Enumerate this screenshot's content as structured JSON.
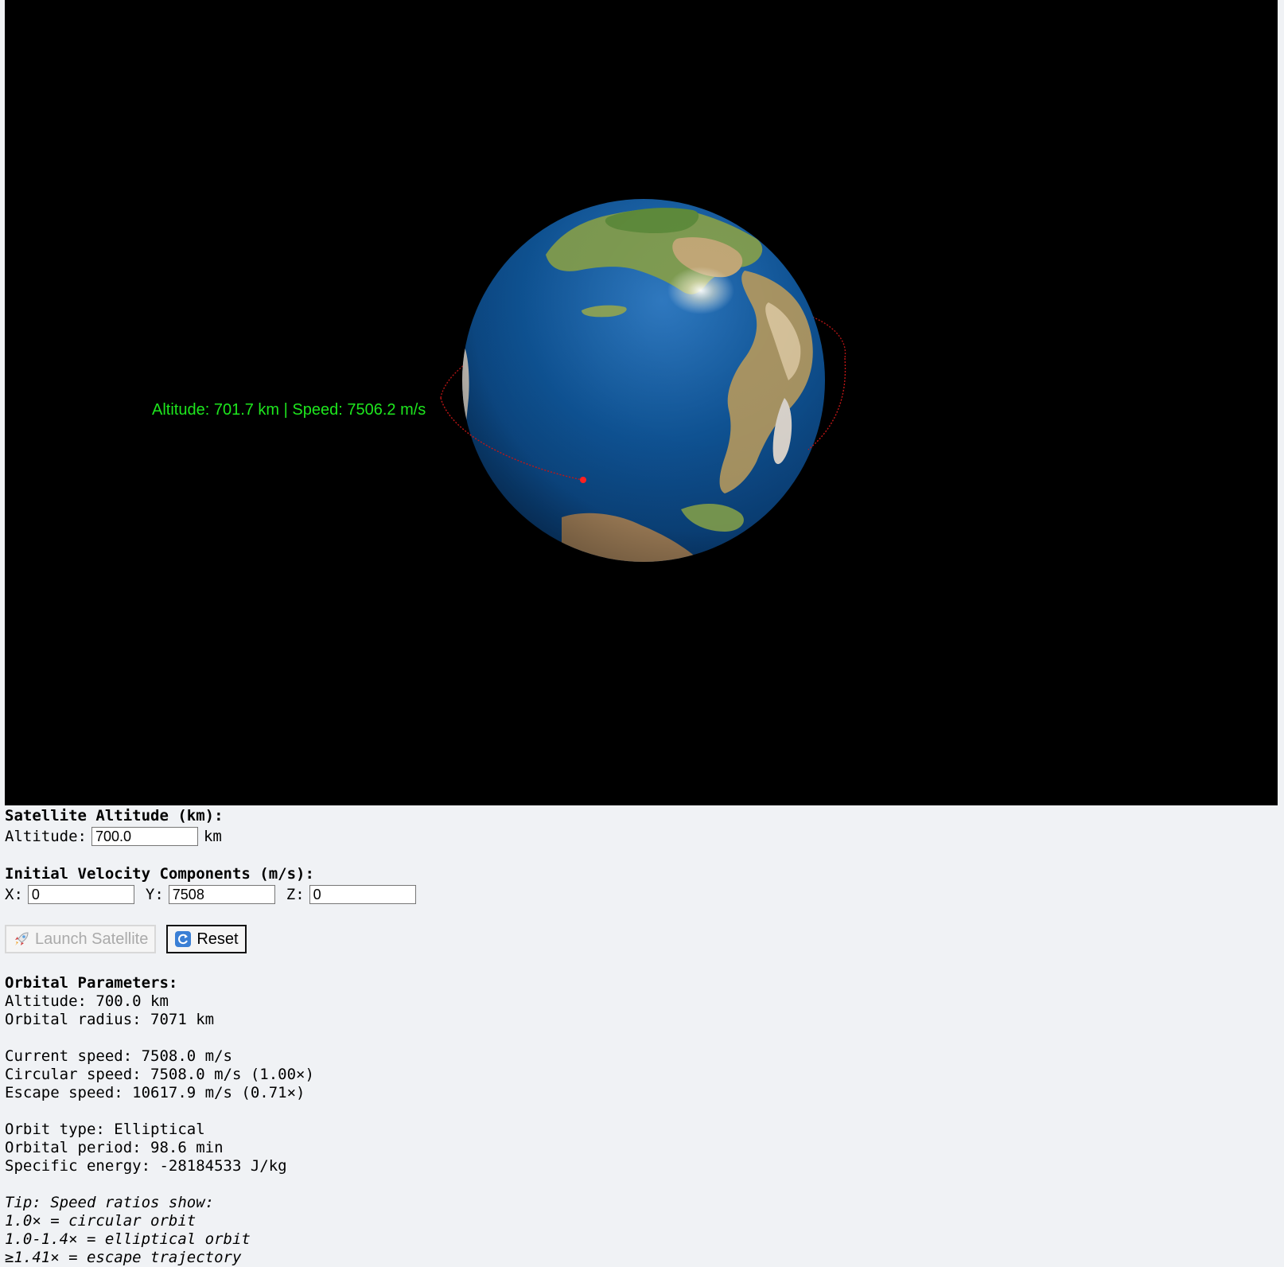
{
  "hud": {
    "readout": "Altitude: 701.7 km | Speed: 7506.2 m/s"
  },
  "altitude_section": {
    "title": "Satellite Altitude (km):",
    "label": "Altitude:",
    "value": "700.0",
    "unit": "km"
  },
  "velocity_section": {
    "title": "Initial Velocity Components (m/s):",
    "x_label": "X:",
    "x_value": "0",
    "y_label": "Y:",
    "y_value": "7508",
    "z_label": "Z:",
    "z_value": "0"
  },
  "buttons": {
    "launch_label": "Launch Satellite",
    "launch_icon": "rocket-icon",
    "launch_disabled": true,
    "reset_label": "Reset",
    "reset_icon": "refresh-icon"
  },
  "orbital_parameters": {
    "title": "Orbital Parameters:",
    "altitude": "Altitude: 700.0 km",
    "orbital_radius": "Orbital radius: 7071 km",
    "current_speed": "Current speed: 7508.0 m/s",
    "circular_speed": "Circular speed: 7508.0 m/s (1.00×)",
    "escape_speed": "Escape speed: 10617.9 m/s (0.71×)",
    "orbit_type": "Orbit type: Elliptical",
    "orbital_period": "Orbital period: 98.6 min",
    "specific_energy": "Specific energy: -28184533 J/kg"
  },
  "tip": {
    "line1": "Tip: Speed ratios show:",
    "line2": "1.0× = circular orbit",
    "line3": "1.0-1.4× = elliptical orbit",
    "line4": "≥1.41× = escape trajectory"
  },
  "colors": {
    "background_scene": "#000000",
    "hud_text": "#1ee61e",
    "orbit_path": "#d01818",
    "satellite": "#ff2020",
    "ocean": "#0b4f93",
    "land": "#7fa14c",
    "panel_bg": "#f0f2f5"
  }
}
